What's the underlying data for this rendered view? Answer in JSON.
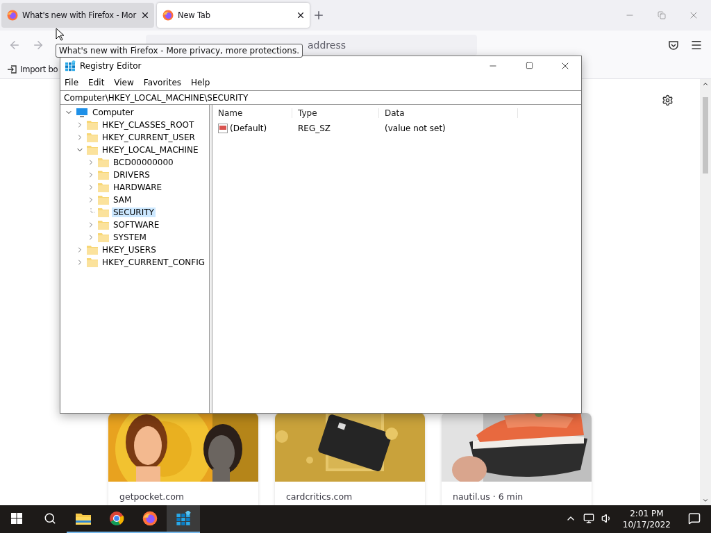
{
  "browser": {
    "tabs": [
      {
        "title": "What's new with Firefox - Mor",
        "selected": false
      },
      {
        "title": "New Tab",
        "selected": true
      }
    ],
    "address_bar": {
      "placeholder": "address"
    },
    "bookmarks": [
      {
        "label": "Import bo"
      }
    ],
    "tooltip": "What's new with Firefox - More privacy, more protections.",
    "cards": [
      {
        "source": "getpocket.com",
        "kind": "picture"
      },
      {
        "source": "cardcritics.com",
        "kind": "picture"
      },
      {
        "source": "nautil.us · 6 min",
        "kind": "picture"
      }
    ]
  },
  "registry": {
    "title": "Registry Editor",
    "menu": [
      "File",
      "Edit",
      "View",
      "Favorites",
      "Help"
    ],
    "path": "Computer\\HKEY_LOCAL_MACHINE\\SECURITY",
    "tree": [
      {
        "label": "Computer",
        "kind": "computer",
        "expandable": true,
        "expanded": true,
        "selected": false,
        "children": [
          {
            "label": "HKEY_CLASSES_ROOT",
            "kind": "folder",
            "expandable": true,
            "expanded": false,
            "selected": false
          },
          {
            "label": "HKEY_CURRENT_USER",
            "kind": "folder",
            "expandable": true,
            "expanded": false,
            "selected": false
          },
          {
            "label": "HKEY_LOCAL_MACHINE",
            "kind": "folder",
            "expandable": true,
            "expanded": true,
            "selected": false,
            "children": [
              {
                "label": "BCD00000000",
                "kind": "folder",
                "expandable": true,
                "expanded": false,
                "selected": false
              },
              {
                "label": "DRIVERS",
                "kind": "folder",
                "expandable": true,
                "expanded": false,
                "selected": false
              },
              {
                "label": "HARDWARE",
                "kind": "folder",
                "expandable": true,
                "expanded": false,
                "selected": false
              },
              {
                "label": "SAM",
                "kind": "folder",
                "expandable": true,
                "expanded": false,
                "selected": false
              },
              {
                "label": "SECURITY",
                "kind": "folder",
                "expandable": false,
                "selected": true
              },
              {
                "label": "SOFTWARE",
                "kind": "folder",
                "expandable": true,
                "expanded": false,
                "selected": false
              },
              {
                "label": "SYSTEM",
                "kind": "folder",
                "expandable": true,
                "expanded": false,
                "selected": false
              }
            ]
          },
          {
            "label": "HKEY_USERS",
            "kind": "folder",
            "expandable": true,
            "expanded": false,
            "selected": false
          },
          {
            "label": "HKEY_CURRENT_CONFIG",
            "kind": "folder",
            "expandable": true,
            "expanded": false,
            "selected": false
          }
        ]
      }
    ],
    "columns": [
      "Name",
      "Type",
      "Data"
    ],
    "rows": [
      {
        "name": "(Default)",
        "type": "REG_SZ",
        "data": "(value not set)"
      }
    ]
  },
  "taskbar": {
    "apps": [
      {
        "kind": "explorer",
        "active": false
      },
      {
        "kind": "chrome",
        "active": false
      },
      {
        "kind": "firefox",
        "active": false
      },
      {
        "kind": "regedit",
        "active": true
      }
    ],
    "time": "2:01 PM",
    "date": "10/17/2022"
  }
}
